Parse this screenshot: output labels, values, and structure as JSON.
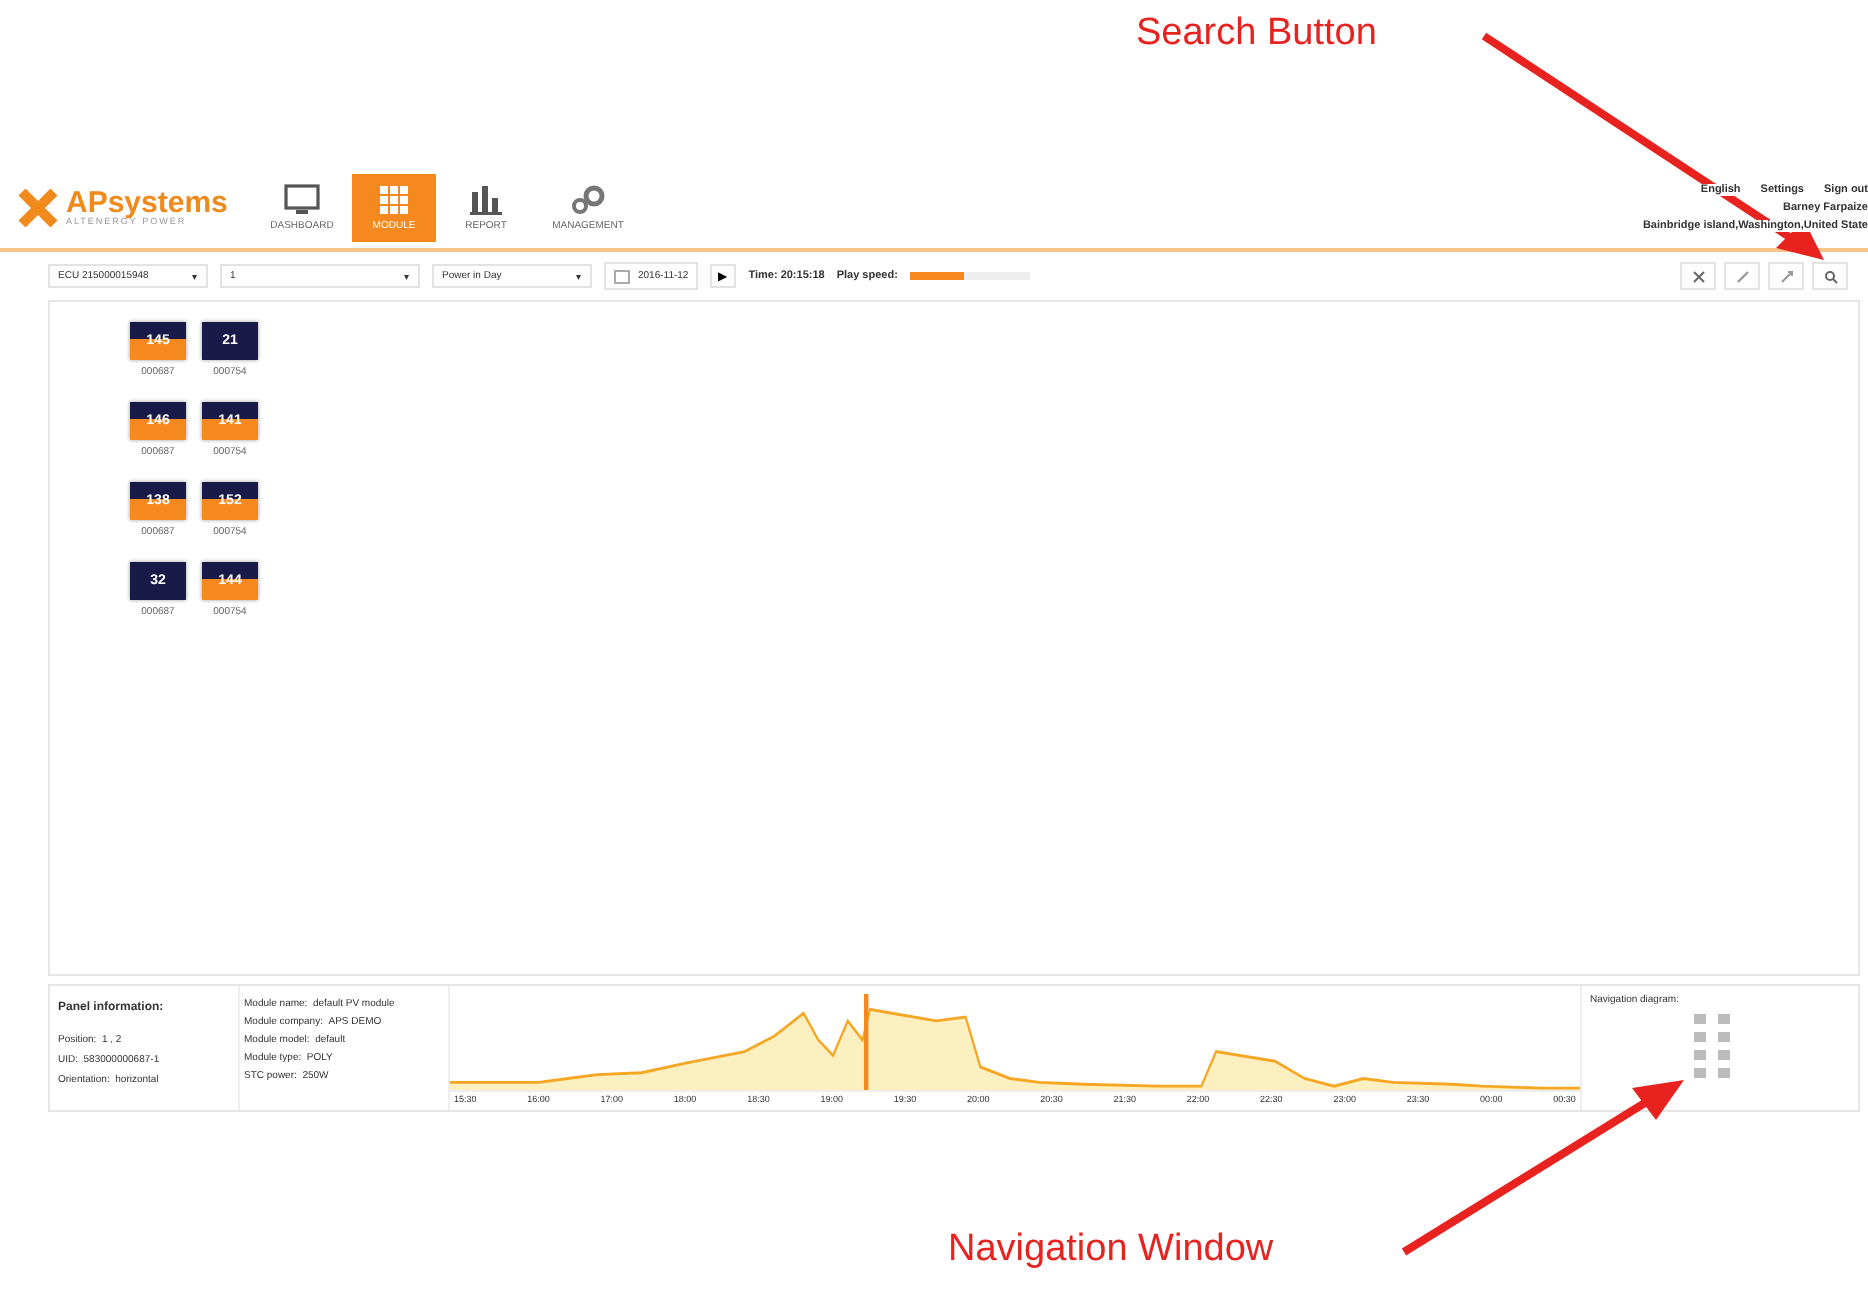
{
  "annotations": [
    {
      "text": "Search Button"
    },
    {
      "text": "Navigation Window"
    }
  ],
  "header": {
    "brand": "APsystems",
    "tagline": "ALTENERGY POWER",
    "nav": [
      {
        "label": "DASHBOARD",
        "selected": false
      },
      {
        "label": "MODULE",
        "selected": true
      },
      {
        "label": "REPORT",
        "selected": false
      },
      {
        "label": "MANAGEMENT",
        "selected": false
      }
    ],
    "links": [
      "English",
      "Settings",
      "Sign out"
    ],
    "user": "Barney Farpaize",
    "location": "Bainbridge island,Washington,United State"
  },
  "toolbar": {
    "selects": [
      {
        "value": "ECU 215000015948",
        "caret": "▾"
      },
      {
        "value": "1",
        "caret": "▾"
      },
      {
        "value": "Power in Day",
        "caret": "▾"
      }
    ],
    "date": "2016-11-12",
    "play": "▶",
    "time": "Time: 20:15:18",
    "speed_label": "Play speed:",
    "speed": {
      "level": 0.45
    }
  },
  "modules": [
    [
      {
        "value": "145",
        "active": true,
        "id": "000687"
      },
      {
        "value": "21",
        "active": false,
        "id": "000754"
      }
    ],
    [
      {
        "value": "146",
        "active": true,
        "id": "000687"
      },
      {
        "value": "141",
        "active": true,
        "id": "000754"
      }
    ],
    [
      {
        "value": "138",
        "active": true,
        "id": "000687"
      },
      {
        "value": "152",
        "active": true,
        "id": "000754"
      }
    ],
    [
      {
        "value": "32",
        "active": false,
        "id": "000687"
      },
      {
        "value": "144",
        "active": true,
        "id": "000754"
      }
    ]
  ],
  "panel_info": {
    "title": "Panel information:",
    "fields": [
      {
        "label": "Position:",
        "value": "1 , 2"
      },
      {
        "label": "UID:",
        "value": "583000000687-1"
      },
      {
        "label": "Orientation:",
        "value": "horizontal"
      }
    ],
    "module": [
      {
        "label": "Module name:",
        "value": "default PV module"
      },
      {
        "label": "Module company:",
        "value": "APS DEMO"
      },
      {
        "label": "Module model:",
        "value": "default"
      },
      {
        "label": "Module type:",
        "value": "POLY"
      },
      {
        "label": "STC power:",
        "value": "250W"
      }
    ]
  },
  "timeline": {
    "x_labels": [
      "15:30",
      "16:00",
      "17:00",
      "18:00",
      "18:30",
      "19:00",
      "19:30",
      "20:00",
      "20:30",
      "21:30",
      "22:00",
      "22:30",
      "23:00",
      "23:30",
      "00:00",
      "00:30"
    ]
  },
  "navigation": {
    "title": "Navigation diagram:"
  }
}
